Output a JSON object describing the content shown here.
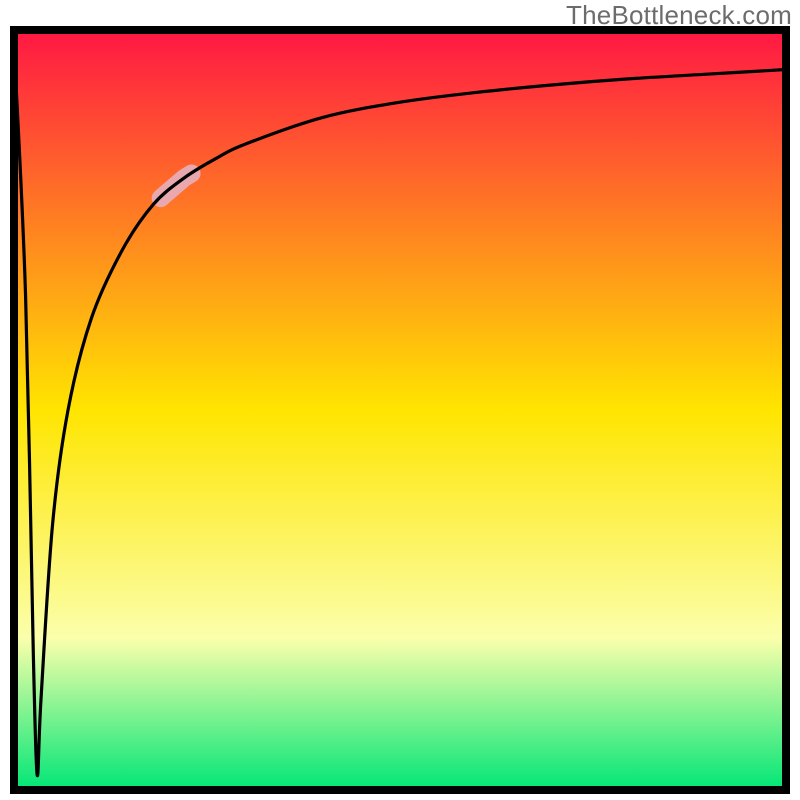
{
  "watermark": "TheBottleneck.com",
  "chart_data": {
    "type": "line",
    "title": "",
    "xlabel": "",
    "ylabel": "",
    "xlim": [
      0,
      100
    ],
    "ylim": [
      0,
      100
    ],
    "grid": false,
    "legend": false,
    "gradient_stops": [
      {
        "offset": 0,
        "color": "#ff1744"
      },
      {
        "offset": 50,
        "color": "#ffe500"
      },
      {
        "offset": 80,
        "color": "#fbffab"
      },
      {
        "offset": 100,
        "color": "#00e676"
      }
    ],
    "curve": {
      "description": "Bottleneck curve: sharp drop near x≈3 to ~0, then asymptotic rise toward ~95 as x→100",
      "x": [
        0,
        1.5,
        2.5,
        3,
        3.5,
        5,
        7,
        10,
        14,
        18,
        22,
        26,
        30,
        40,
        50,
        60,
        70,
        80,
        90,
        100
      ],
      "y": [
        98,
        65,
        18,
        2,
        12,
        35,
        50,
        62,
        71,
        77,
        80.5,
        83,
        85,
        88.5,
        90.5,
        91.8,
        92.8,
        93.6,
        94.2,
        94.8
      ]
    },
    "highlight_segment": {
      "description": "Pale pink segment on the curve",
      "x_range": [
        19,
        23
      ],
      "color": "#e9a8ad",
      "width": 18
    },
    "border": {
      "color": "#000000",
      "width": 8
    }
  }
}
